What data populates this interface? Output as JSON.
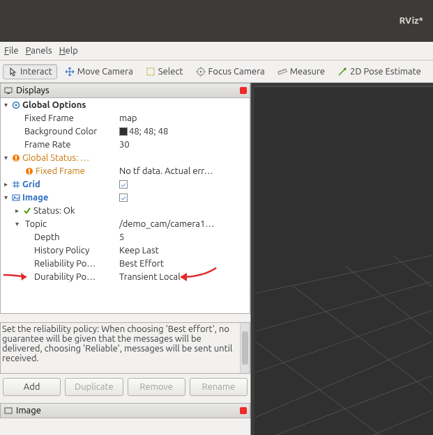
{
  "window": {
    "title": "RViz*"
  },
  "menu": {
    "file": "File",
    "panels": "Panels",
    "help": "Help"
  },
  "toolbar": {
    "interact": "Interact",
    "move_camera": "Move Camera",
    "select": "Select",
    "focus_camera": "Focus Camera",
    "measure": "Measure",
    "pose_estimate": "2D Pose Estimate"
  },
  "panels": {
    "displays": "Displays",
    "image": "Image"
  },
  "tree": {
    "global_options": {
      "label": "Global Options",
      "fixed_frame": {
        "label": "Fixed Frame",
        "value": "map"
      },
      "background_color": {
        "label": "Background Color",
        "value": "48; 48; 48"
      },
      "frame_rate": {
        "label": "Frame Rate",
        "value": "30"
      }
    },
    "global_status": {
      "label": "Global Status: …",
      "fixed_frame": {
        "label": "Fixed Frame",
        "value": "No tf data.  Actual err…"
      }
    },
    "grid": {
      "label": "Grid"
    },
    "image": {
      "label": "Image",
      "status": {
        "label": "Status: Ok"
      },
      "topic": {
        "label": "Topic",
        "value": "/demo_cam/camera1…"
      },
      "depth": {
        "label": "Depth",
        "value": "5"
      },
      "history_policy": {
        "label": "History Policy",
        "value": "Keep Last"
      },
      "reliability_policy": {
        "label": "Reliability Po…",
        "value": "Best Effort"
      },
      "durability_policy": {
        "label": "Durability Po…",
        "value": "Transient Local"
      }
    }
  },
  "description": {
    "text": "Set the reliability policy: When choosing 'Best effort', no guarantee will be given that the messages will be delivered, choosing 'Reliable', messages will be sent until received."
  },
  "buttons": {
    "add": "Add",
    "duplicate": "Duplicate",
    "remove": "Remove",
    "rename": "Rename"
  }
}
